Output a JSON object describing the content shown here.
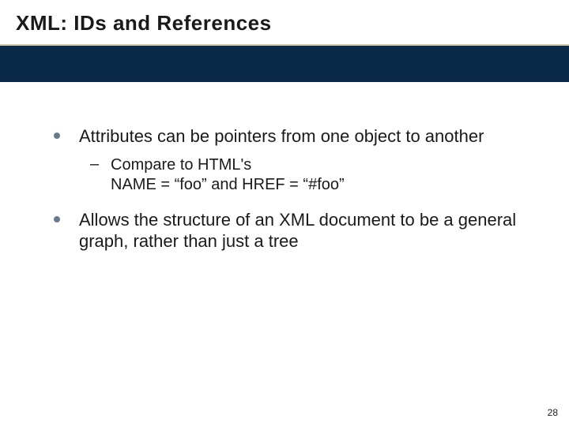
{
  "slide": {
    "title": "XML: IDs and References",
    "bullets": [
      {
        "text": "Attributes can be pointers from one object to another",
        "sub": [
          {
            "line1": "Compare to HTML's",
            "line2": "NAME = “foo” and HREF = “#foo”"
          }
        ]
      },
      {
        "text": "Allows the structure of an XML document to be a general graph, rather than just a tree",
        "sub": []
      }
    ],
    "page_number": "28"
  }
}
